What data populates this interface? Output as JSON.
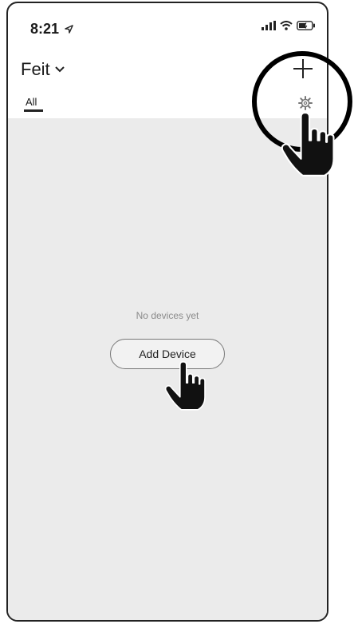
{
  "status_bar": {
    "time": "8:21"
  },
  "header": {
    "home_name": "Feit"
  },
  "tabs": [
    {
      "label": "All"
    }
  ],
  "empty_state": {
    "message": "No devices yet",
    "button_label": "Add Device"
  },
  "icons": {
    "location": "location-arrow-icon",
    "signal": "signal-icon",
    "wifi": "wifi-icon",
    "battery": "battery-icon",
    "dropdown": "chevron-down-icon",
    "add": "plus-icon",
    "settings": "gear-icon",
    "pointer": "pointing-hand-icon"
  },
  "colors": {
    "background": "#ffffff",
    "content_background": "#ebebeb",
    "text": "#1a1a1a",
    "muted_text": "#8a8a8a"
  }
}
